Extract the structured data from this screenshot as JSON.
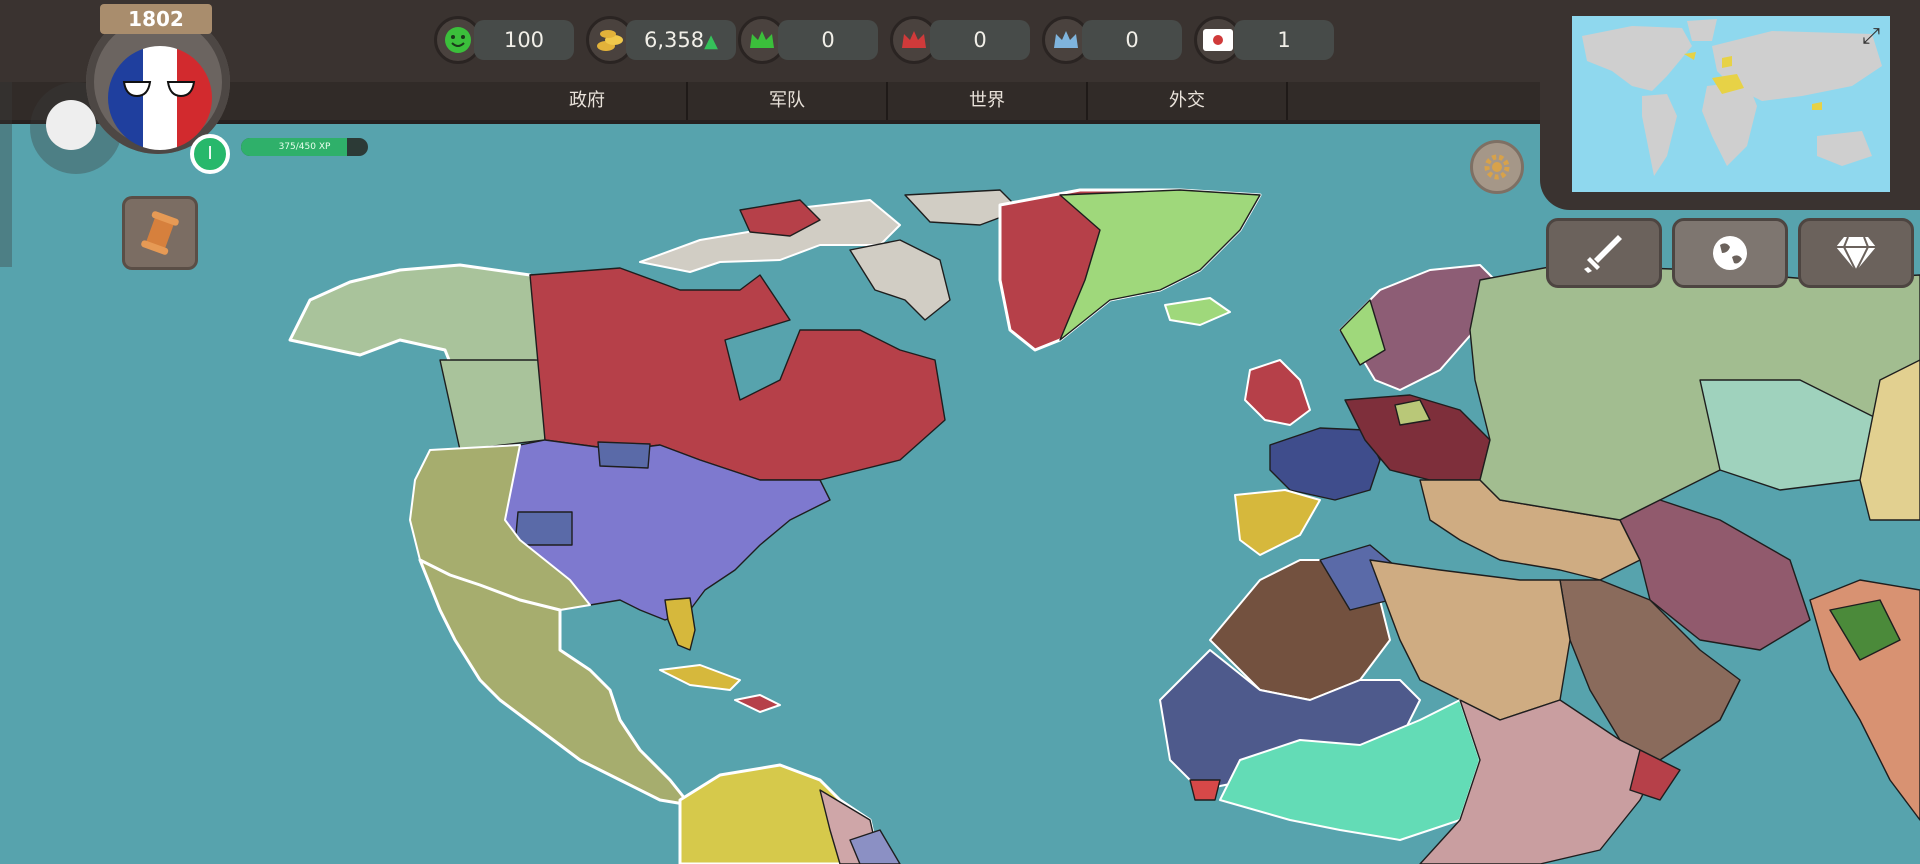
{
  "year": "1802",
  "player": {
    "country_flag": [
      "#1f3f9e",
      "#ffffff",
      "#d22a2e"
    ],
    "level": "I",
    "xp_text": "375/450 XP",
    "xp_progress": 0.833
  },
  "resources": [
    {
      "icon": "smiley-icon",
      "value": "100",
      "color": "#3bbf3b"
    },
    {
      "icon": "coins-icon",
      "value": "6,358",
      "trend": "up",
      "color": "#e2b23a"
    },
    {
      "icon": "crown-green-icon",
      "value": "0",
      "color": "#3bbf3b"
    },
    {
      "icon": "crown-red-icon",
      "value": "0",
      "color": "#d03a3a"
    },
    {
      "icon": "crown-blue-icon",
      "value": "0",
      "color": "#7fb4dd"
    },
    {
      "icon": "japan-flag-icon",
      "value": "1",
      "color": "#d03a3a"
    }
  ],
  "tabs": [
    "政府",
    "军队",
    "世界",
    "外交"
  ],
  "right_buttons": [
    "sword-icon",
    "globe-icon",
    "diamond-icon"
  ],
  "colors": {
    "ocean": "#57a3ad",
    "usa": "#7e79cf",
    "britain": "#b64049",
    "france": "#3f4d8c",
    "spain": "#d6b83c",
    "russia": "#a2bd90",
    "ottoman": "#cfac82",
    "mexico": "#a6ad6e",
    "greenland": "#9fd87b",
    "africa_mint": "#63dcb6",
    "persia": "#915a6d",
    "morocco": "#73513f"
  }
}
